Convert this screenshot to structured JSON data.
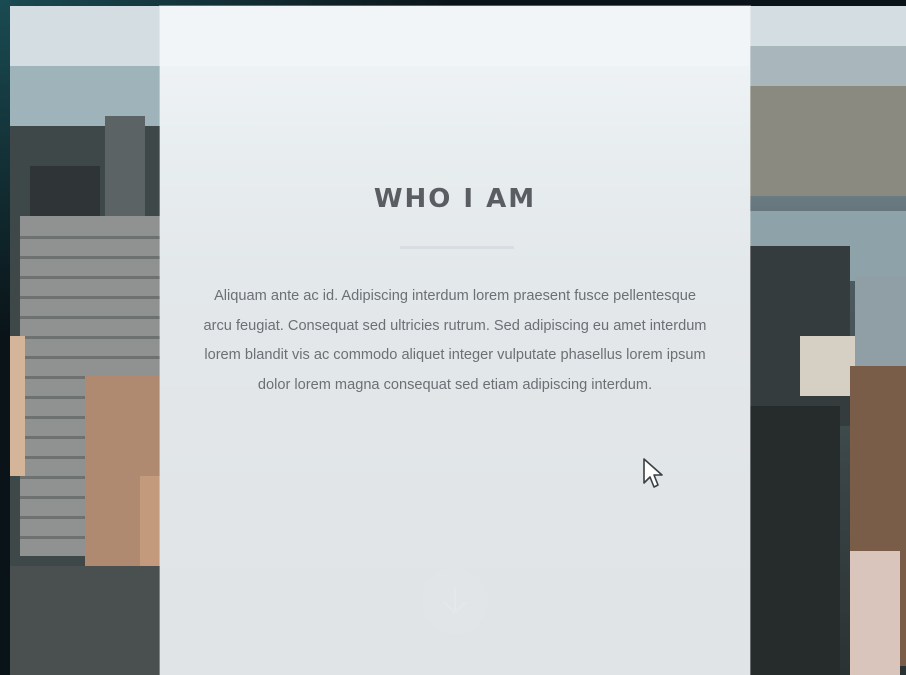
{
  "section": {
    "title": "WHO I AM",
    "body": "Aliquam ante ac id. Adipiscing interdum lorem praesent fusce pellentesque arcu feugiat. Consequat sed ultricies rutrum. Sed adipiscing eu amet interdum lorem blandit vis ac commodo aliquet integer vulputate phasellus lorem ipsum dolor lorem magna consequat sed etiam adipiscing interdum."
  },
  "icons": {
    "scroll_down": "arrow-down-icon",
    "cursor": "mouse-pointer-icon"
  },
  "colors": {
    "panel": "#f4f7fa",
    "heading": "#5a5e63",
    "body_text": "#6c7075",
    "divider": "#d9dde1"
  }
}
